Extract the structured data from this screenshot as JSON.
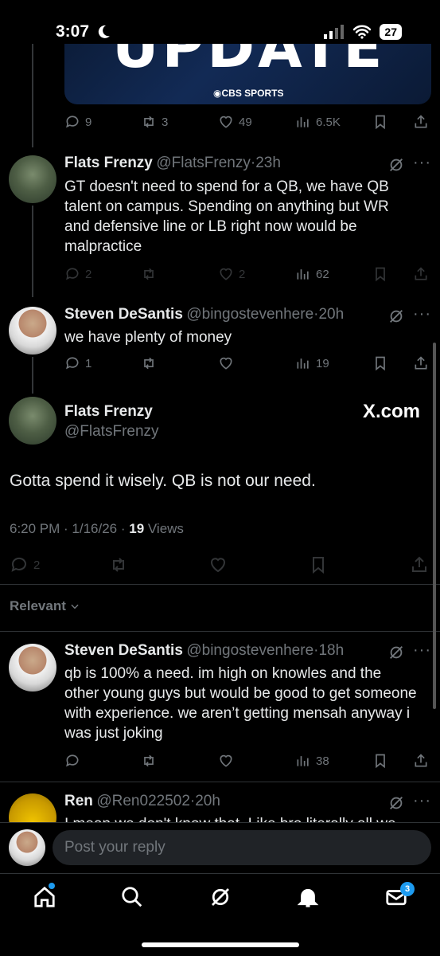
{
  "status": {
    "time": "3:07",
    "battery": "27"
  },
  "media": {
    "headline": "UPDATE",
    "source": "CBS SPORTS"
  },
  "prev_actions": {
    "replies": "9",
    "retweets": "3",
    "likes": "49",
    "views": "6.5K"
  },
  "replies": [
    {
      "name": "Flats Frenzy",
      "handle": "@FlatsFrenzy",
      "time": "23h",
      "text": "GT doesn't need to spend for a QB, we have QB talent on campus.  Spending on anything but WR and defensive line or LB right now would be malpractice",
      "replies": "2",
      "likes": "2",
      "views": "62"
    },
    {
      "name": "Steven DeSantis",
      "handle": "@bingostevenhere",
      "time": "20h",
      "text": "we have plenty of money",
      "replies": "1",
      "views": "19"
    }
  ],
  "main_tweet": {
    "name": "Flats Frenzy",
    "handle": "@FlatsFrenzy",
    "brand": "X.com",
    "text": "Gotta spend it wisely.  QB is not our need.",
    "timestamp": "6:20 PM · 1/16/26 · ",
    "views_count": "19",
    "views_label": " Views",
    "replies": "2"
  },
  "sort_label": "Relevant",
  "thread_replies": [
    {
      "name": "Steven DeSantis",
      "handle": "@bingostevenhere",
      "time": "18h",
      "text": "qb is 100% a need. im high on knowles and the other young guys but would be good to get someone with experience. we aren’t getting mensah anyway i was just joking",
      "views": "38"
    },
    {
      "name": "Ren",
      "handle": "@Ren022502",
      "time": "20h",
      "text": "I mean we don't know that. Like bro literally all we"
    }
  ],
  "reply_placeholder": "Post your reply",
  "tabbar": {
    "messages_badge": "3"
  }
}
